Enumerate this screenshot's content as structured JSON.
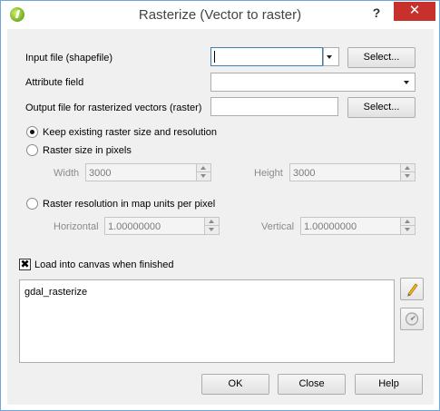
{
  "window": {
    "title": "Rasterize (Vector to raster)",
    "help_glyph": "?",
    "close_glyph": "✕"
  },
  "input_file": {
    "label": "Input file (shapefile)",
    "value": "",
    "select_label": "Select..."
  },
  "attribute_field": {
    "label": "Attribute field",
    "value": ""
  },
  "output_file": {
    "label": "Output file for rasterized vectors (raster)",
    "value": "",
    "select_label": "Select..."
  },
  "options": {
    "keep_existing": {
      "label": "Keep existing raster size and resolution",
      "checked": true
    },
    "raster_size": {
      "label": "Raster size in pixels",
      "checked": false,
      "width_label": "Width",
      "width_value": "3000",
      "height_label": "Height",
      "height_value": "3000"
    },
    "raster_resolution": {
      "label": "Raster resolution in map units per pixel",
      "checked": false,
      "horizontal_label": "Horizontal",
      "horizontal_value": "1.00000000",
      "vertical_label": "Vertical",
      "vertical_value": "1.00000000"
    }
  },
  "load_canvas": {
    "label": "Load into canvas when finished",
    "checked": true,
    "mark": "✖"
  },
  "command": {
    "text": "gdal_rasterize"
  },
  "buttons": {
    "ok": "OK",
    "close": "Close",
    "help": "Help"
  },
  "icons": {
    "app": "qgis-logo-icon",
    "edit": "pencil-icon",
    "reset": "reset-icon"
  },
  "colors": {
    "close_button": "#c7302b",
    "window_border": "#6fa6da",
    "background": "#f0f0f0"
  }
}
